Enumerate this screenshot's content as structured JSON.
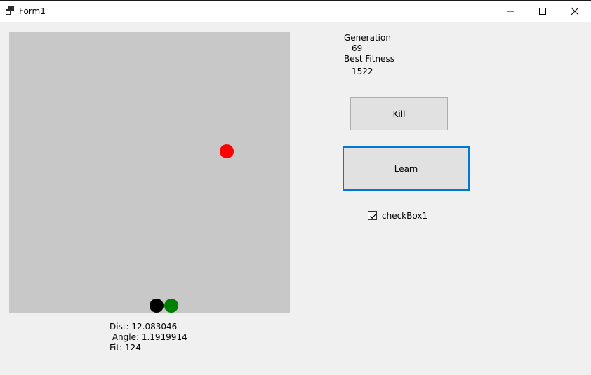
{
  "window": {
    "title": "Form1",
    "icons": [
      "form-icon",
      "minimize-icon",
      "maximize-icon",
      "close-icon"
    ]
  },
  "simulation": {
    "background_color": "#c8c8c8",
    "balls": [
      {
        "name": "target",
        "color": "#ff0000"
      },
      {
        "name": "agent",
        "color": "#000000"
      },
      {
        "name": "agent-best",
        "color": "#008000"
      }
    ]
  },
  "stats_panel": {
    "generation_label": "Generation",
    "generation_value": "69",
    "best_fitness_label": "Best Fitness",
    "best_fitness_value": "1522"
  },
  "buttons": {
    "kill_label": "Kill",
    "learn_label": "Learn"
  },
  "checkbox": {
    "label": "checkBox1",
    "checked": true
  },
  "readout": {
    "dist": "Dist: 12.083046",
    "angle": " Angle: 1.1919914",
    "fit": "Fit: 124"
  },
  "colors": {
    "focus_border": "#0078d7",
    "button_face": "#e1e1e1",
    "form_background": "#f0f0f0"
  }
}
